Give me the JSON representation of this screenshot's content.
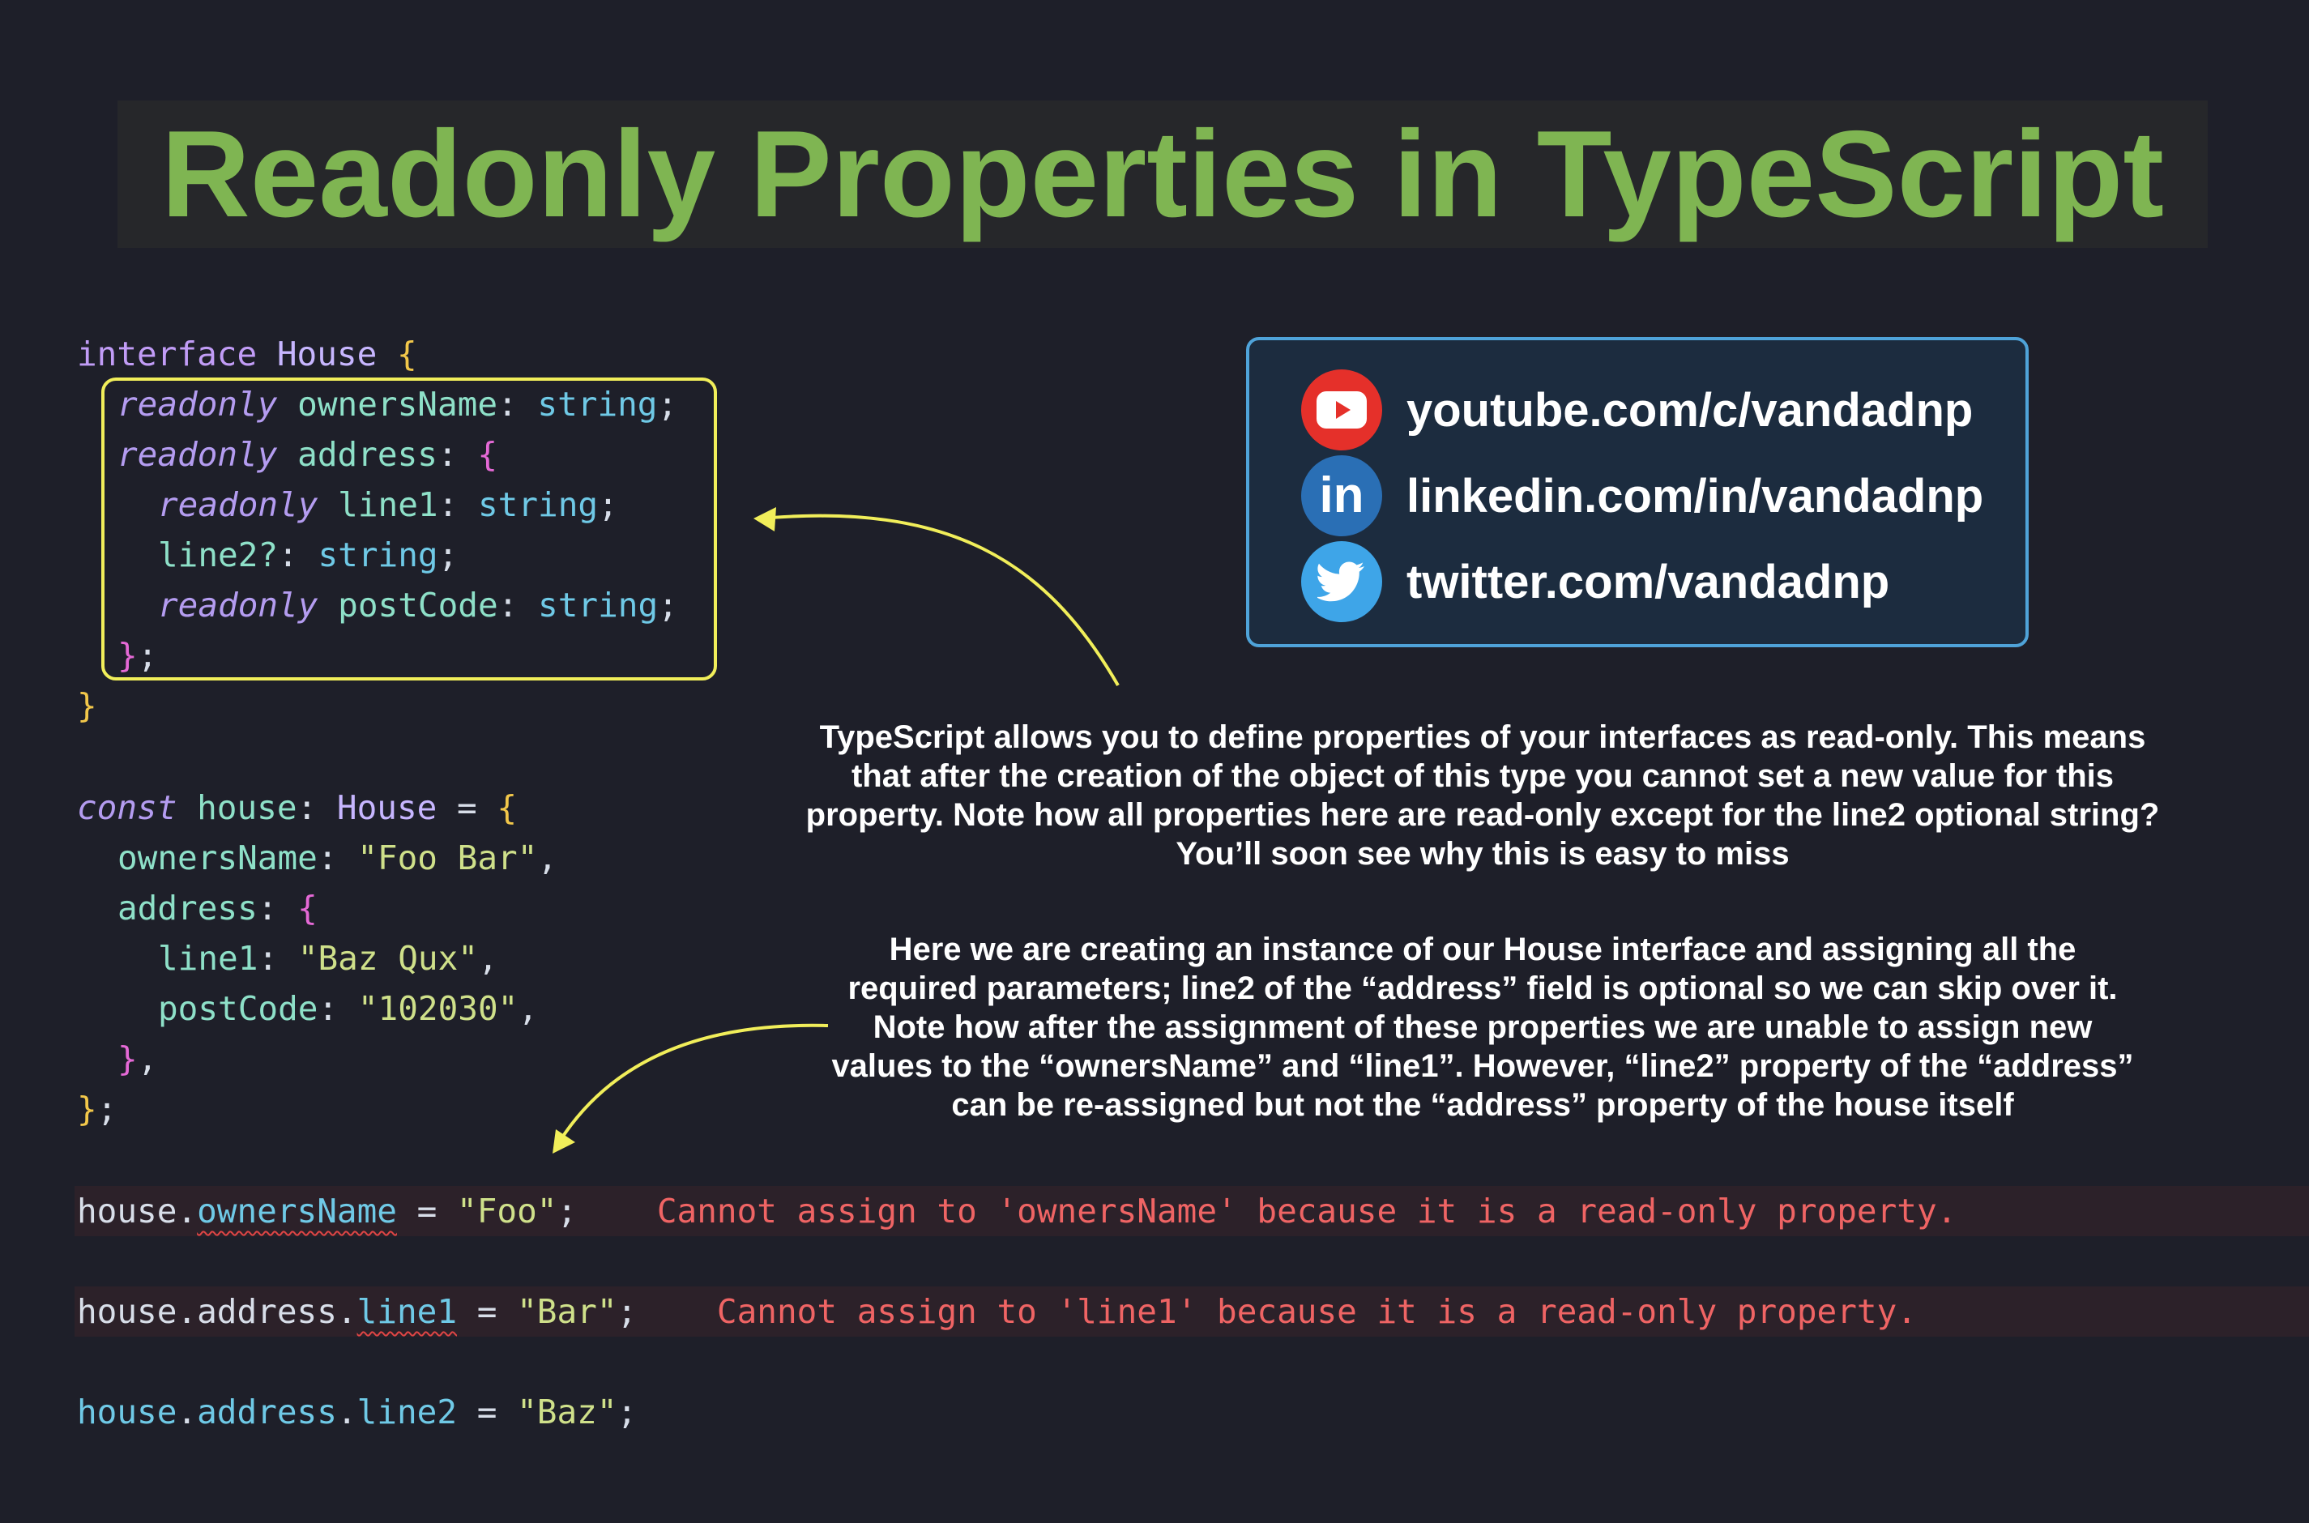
{
  "title": "Readonly Properties in TypeScript",
  "code": {
    "interface_kw": "interface",
    "interface_name": "House",
    "readonly_kw": "readonly",
    "owners_name_prop": "ownersName",
    "address_prop": "address",
    "line1_prop": "line1",
    "line2_opt_prop": "line2?",
    "post_code_prop": "postCode",
    "string_type": "string",
    "const_kw": "const",
    "house_var": "house",
    "owners_name_value": "\"Foo Bar\"",
    "line1_value": "\"Baz Qux\"",
    "post_code_value": "\"102030\"",
    "assign1_value": "\"Foo\"",
    "assign2_value": "\"Bar\"",
    "assign3_value": "\"Baz\"",
    "line2_prop": "line2"
  },
  "errors": {
    "owners_name": "Cannot assign to 'ownersName' because it is a read-only property.",
    "line1": "Cannot assign to 'line1' because it is a read-only property."
  },
  "social": {
    "youtube": "youtube.com/c/vandadnp",
    "linkedin": "linkedin.com/in/vandadnp",
    "twitter": "twitter.com/vandadnp",
    "linkedin_icon_text": "in"
  },
  "notes": {
    "paragraph1": [
      "TypeScript allows you to define properties of your interfaces as read-only. This means",
      "that after the creation of the object of this type you cannot set a new value for this",
      "property. Note how all properties here are read-only except for the line2 optional string?",
      "You’ll soon see why this is easy to miss"
    ],
    "paragraph2": [
      "Here we are creating an instance of our House interface and assigning all the",
      "required parameters; line2 of the “address” field is optional so we can skip over it.",
      "Note how after the assignment of these properties we are unable to assign new",
      "values to the “ownersName” and “line1”. However, “line2” property of the “address”",
      "can be re-assigned but not the “address” property of the house itself"
    ]
  },
  "colors": {
    "background": "#1e1f29",
    "title": "#7fb552",
    "highlight_box": "#f1ee5a",
    "error_text": "#ef6464",
    "social_border": "#4fa3d9",
    "youtube_red": "#e5302a",
    "linkedin_blue": "#2a6fb5",
    "twitter_blue": "#3ea5e8"
  }
}
